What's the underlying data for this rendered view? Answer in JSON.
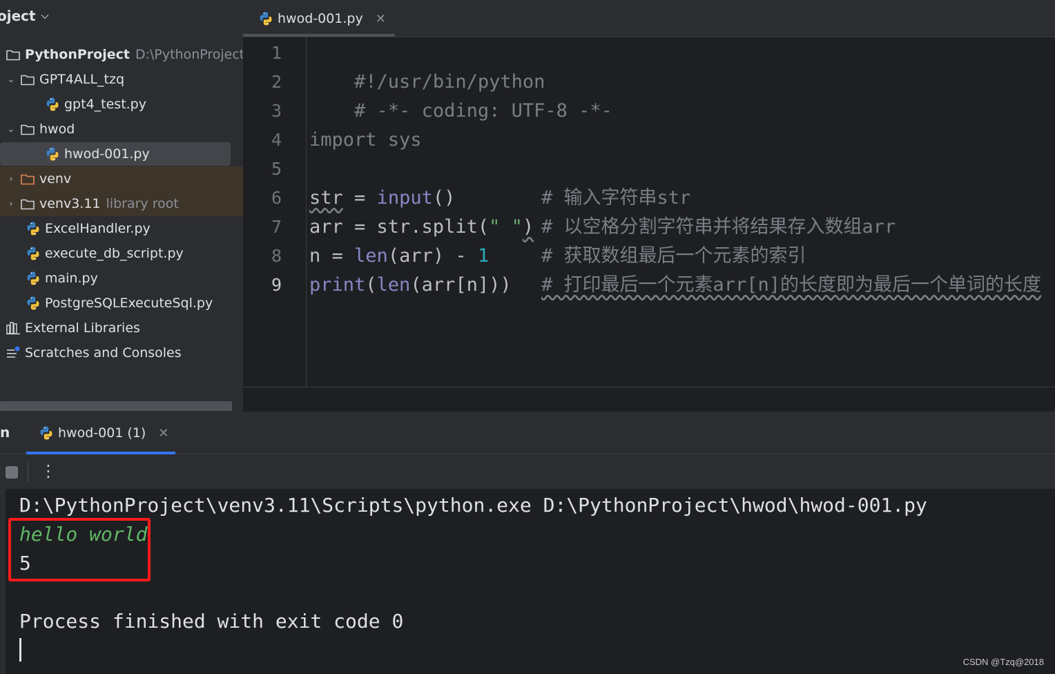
{
  "project": {
    "header": "oject",
    "tree": [
      {
        "label": "PythonProject",
        "hint": "D:\\PythonProject",
        "type": "folder",
        "bold": true
      },
      {
        "label": "GPT4ALL_tzq",
        "type": "folder",
        "expanded": true
      },
      {
        "label": "gpt4_test.py",
        "type": "python"
      },
      {
        "label": "hwod",
        "type": "folder",
        "expanded": true
      },
      {
        "label": "hwod-001.py",
        "type": "python",
        "selected": true
      },
      {
        "label": "venv",
        "type": "folder-excluded"
      },
      {
        "label": "venv3.11",
        "hint": "library root",
        "type": "folder"
      },
      {
        "label": "ExcelHandler.py",
        "type": "python"
      },
      {
        "label": "execute_db_script.py",
        "type": "python"
      },
      {
        "label": "main.py",
        "type": "python"
      },
      {
        "label": "PostgreSQLExecuteSql.py",
        "type": "python"
      },
      {
        "label": "External Libraries",
        "type": "libraries"
      },
      {
        "label": "Scratches and Consoles",
        "type": "scratches"
      }
    ]
  },
  "editor": {
    "tab_label": "hwod-001.py",
    "line_numbers": [
      "1",
      "2",
      "3",
      "4",
      "5",
      "6",
      "7",
      "8",
      "9"
    ],
    "current_line": 9,
    "code": {
      "l1": "#!/usr/bin/python",
      "l2": "# -*- coding: UTF-8 -*-",
      "l4_kw": "import",
      "l4_rest": " sys",
      "l6_var": "str",
      "l6_eq": " = ",
      "l6_fn": "input",
      "l6_paren": "()",
      "l6_com": "# 输入字符串str",
      "l7_a": "arr = str.split(",
      "l7_str": "\" \"",
      "l7_b": ")",
      "l7_com": "# 以空格分割字符串并将结果存入数组arr",
      "l8_a": "n = ",
      "l8_fn": "len",
      "l8_b": "(arr) - ",
      "l8_num": "1",
      "l8_com": "# 获取数组最后一个元素的索引",
      "l9_print": "print",
      "l9_open": "(",
      "l9_len": "len",
      "l9_rest": "(arr[n]))",
      "l9_com": "# 打印最后一个元素arr[n]的长度即为最后一个单词的长度"
    }
  },
  "run": {
    "label": "n",
    "tab_label": "hwod-001 (1)",
    "console": {
      "command": "D:\\PythonProject\\venv3.11\\Scripts\\python.exe D:\\PythonProject\\hwod\\hwod-001.py",
      "input": "hello world",
      "output": "5",
      "exit": "Process finished with exit code 0"
    }
  },
  "watermark": "CSDN @Tzq@2018",
  "icons": {
    "folder": "folder-icon",
    "python": "python-file-icon",
    "libraries": "libraries-icon",
    "scratches": "scratches-icon"
  },
  "colors": {
    "accent": "#3574f0",
    "highlight_box": "#ff1a1a",
    "excluded_row": "#3e352a"
  }
}
